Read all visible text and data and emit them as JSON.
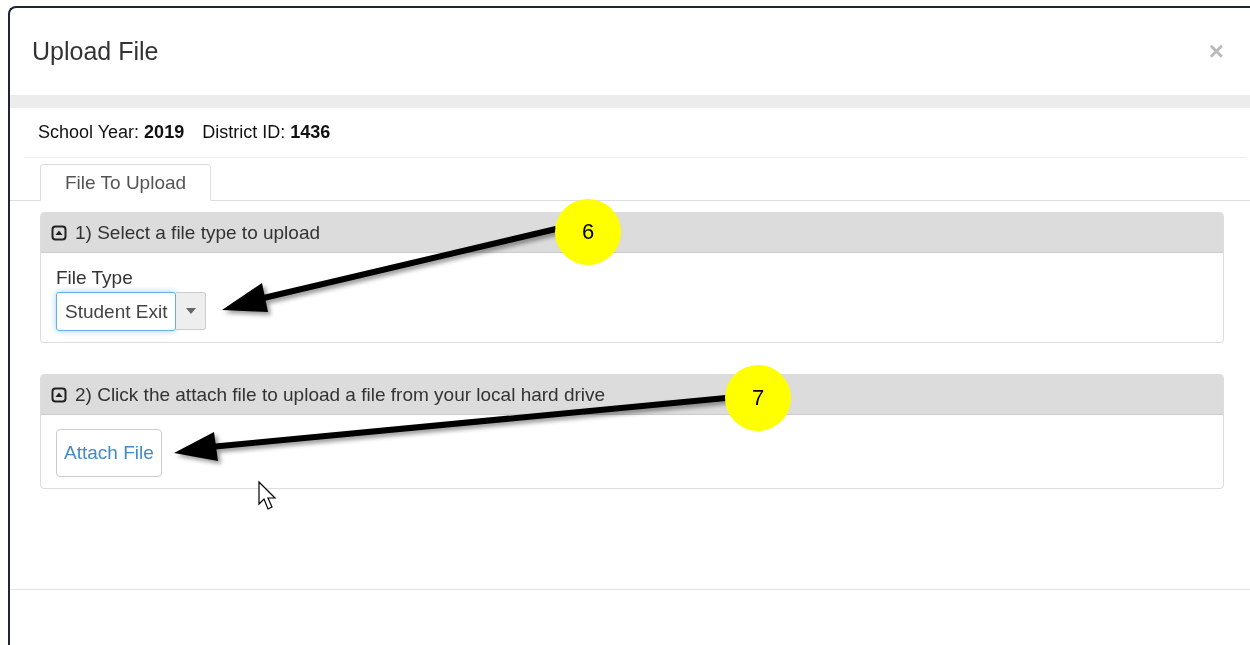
{
  "dialog": {
    "title": "Upload File",
    "close": "×"
  },
  "info": [
    {
      "label": "School Year:",
      "value": "2019"
    },
    {
      "label": "District ID:",
      "value": "1436"
    }
  ],
  "tabs": [
    {
      "label": "File To Upload",
      "selected": true
    }
  ],
  "sections": [
    {
      "kind": "select",
      "heading": "1) Select a file type to upload",
      "expanded": true,
      "field_label": "File Type",
      "value": "Student Exit"
    },
    {
      "kind": "attach",
      "heading": "2) Click the attach file to upload a file from your local hard drive",
      "expanded": true,
      "button": "Attach File"
    }
  ],
  "callouts": [
    {
      "number": "6"
    },
    {
      "number": "7"
    }
  ]
}
